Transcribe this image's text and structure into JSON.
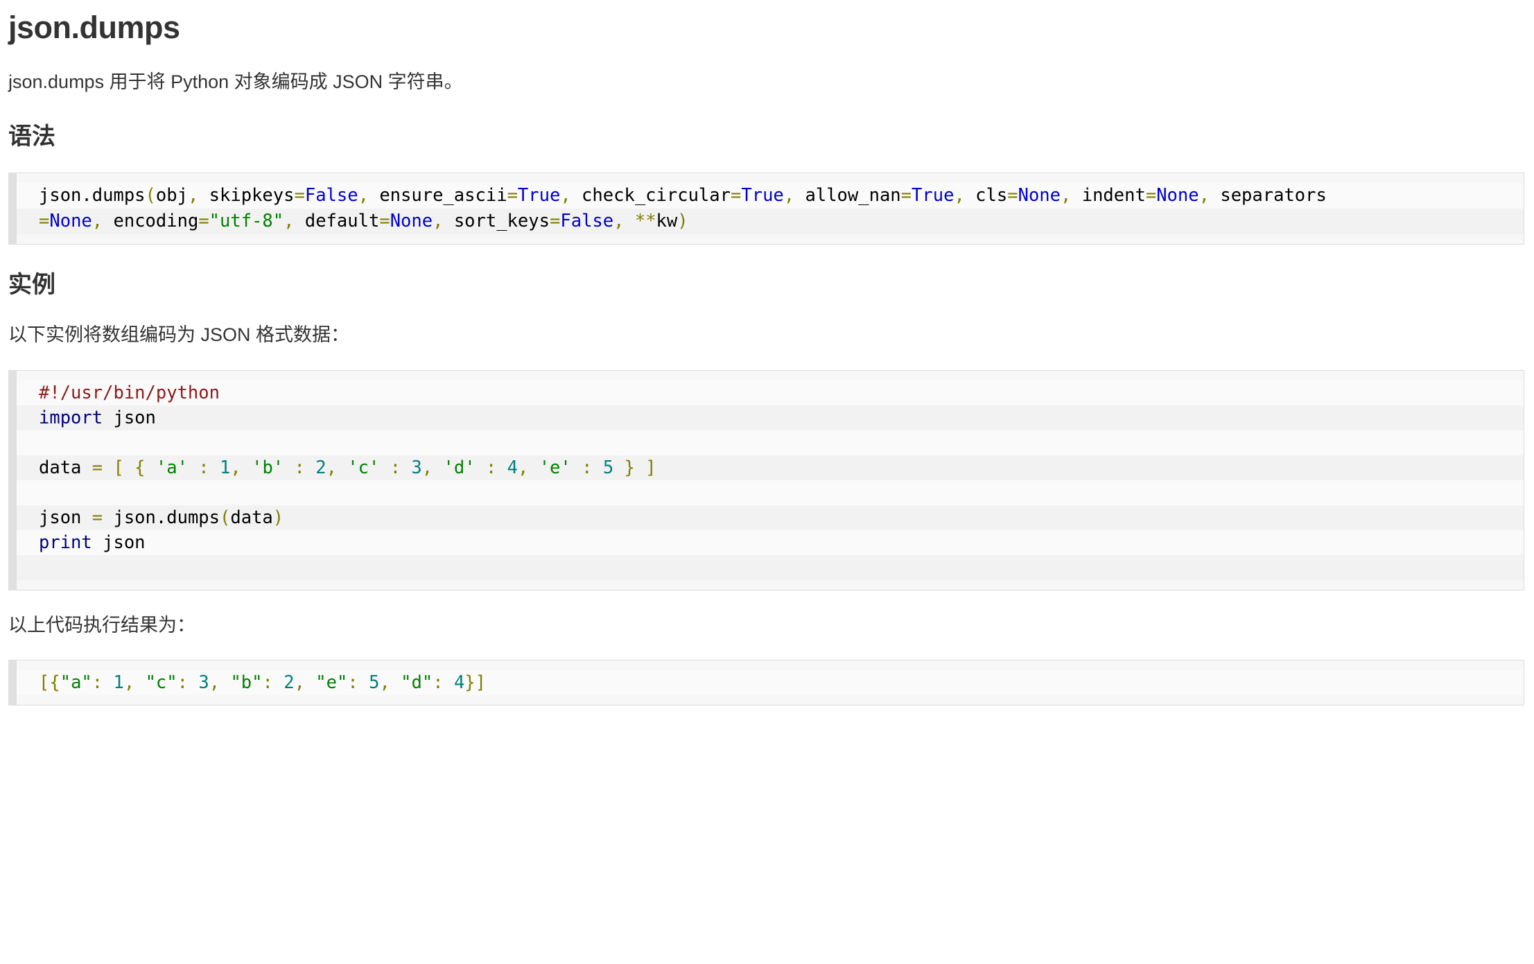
{
  "page": {
    "title": "json.dumps",
    "intro": "json.dumps 用于将 Python 对象编码成 JSON 字符串。"
  },
  "sections": {
    "syntax": {
      "heading": "语法",
      "code_lines": [
        "json.dumps(obj, skipkeys=False, ensure_ascii=True, check_circular=True, allow_nan=True, cls=None, indent=None, separators",
        "=None, encoding=\"utf-8\", default=None, sort_keys=False, **kw)"
      ]
    },
    "example": {
      "heading": "实例",
      "intro": "以下实例将数组编码为 JSON 格式数据：",
      "code_lines": [
        "#!/usr/bin/python",
        "import json",
        "",
        "data = [ { 'a' : 1, 'b' : 2, 'c' : 3, 'd' : 4, 'e' : 5 } ]",
        "",
        "json = json.dumps(data)",
        "print json",
        ""
      ],
      "result_intro": "以上代码执行结果为：",
      "result_lines": [
        "[{\"a\": 1, \"c\": 3, \"b\": 2, \"e\": 5, \"d\": 4}]"
      ]
    }
  },
  "colors": {
    "text": "#333333",
    "code_bg": "#f7f7f7",
    "code_border": "#dddddd",
    "code_left_bar": "#e0e0e0",
    "stripe_odd": "#fafafa",
    "stripe_even": "#f2f2f2",
    "keyword": "#0000cd",
    "keyword_stmt": "#000080",
    "string": "#008000",
    "number": "#007f7f",
    "punctuation": "#808000",
    "comment": "#8b1a1a"
  }
}
